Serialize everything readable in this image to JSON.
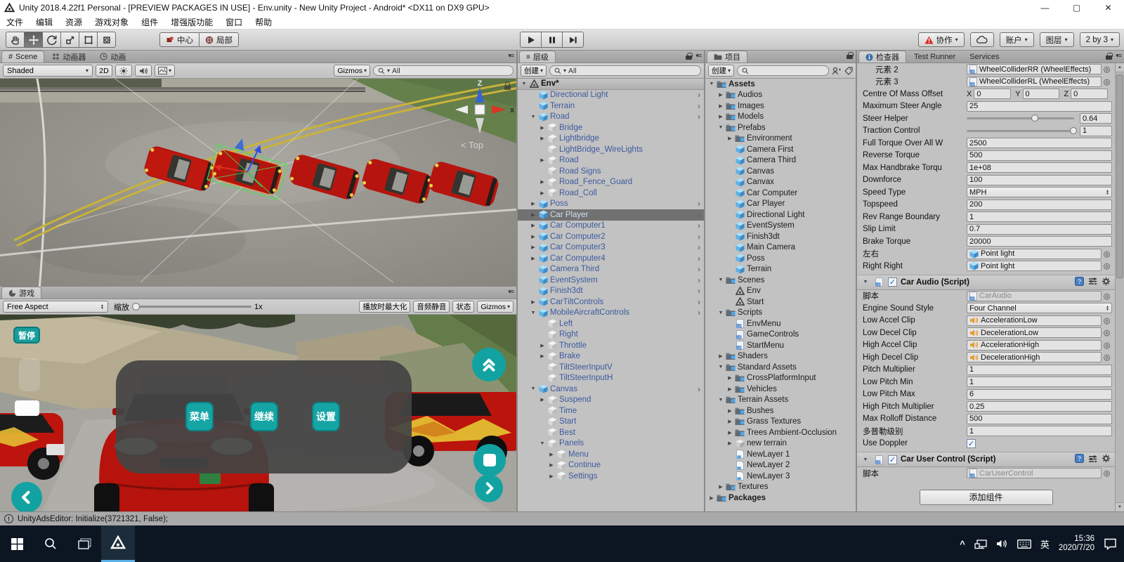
{
  "window": {
    "title": "Unity 2018.4.22f1 Personal - [PREVIEW PACKAGES IN USE] - Env.unity - New Unity Project - Android* <DX11 on DX9 GPU>",
    "menus": [
      "文件",
      "编辑",
      "资源",
      "游戏对象",
      "组件",
      "增强版功能",
      "窗口",
      "帮助"
    ]
  },
  "toolbar": {
    "center_label": "中心",
    "local_label": "局部",
    "collab_label": "协作",
    "account_label": "账户",
    "layers_label": "图层",
    "layout_label": "2 by 3",
    "accent_red": "#d82b1f",
    "tools": [
      "hand-tool",
      "move-tool",
      "rotate-tool",
      "scale-tool",
      "rect-tool",
      "transform-tool"
    ]
  },
  "scene_view": {
    "tabs": [
      {
        "label": "Scene"
      },
      {
        "label": "动画器"
      },
      {
        "label": "动画"
      }
    ],
    "toolbar": {
      "shaded": "Shaded",
      "two_d": "2D",
      "gizmos": "Gizmos",
      "search": "All"
    },
    "gizmo": {
      "z": "Z",
      "x": "x",
      "top_label": "< Top"
    }
  },
  "game_view": {
    "tab": "游戏",
    "toolbar": {
      "aspect": "Free Aspect",
      "zoom_label": "缩放",
      "zoom_value": "1x",
      "maximize": "播放时最大化",
      "mute": "音频静音",
      "stats": "状态",
      "gizmos": "Gizmos"
    },
    "overlay": {
      "pause_label": "暂停",
      "menu_buttons": [
        "菜单",
        "继续",
        "设置"
      ],
      "teal": "#16a5a5"
    }
  },
  "hierarchy": {
    "tab": "层级",
    "create_label": "创建",
    "search": "All",
    "items": [
      {
        "l": "Env*",
        "d": 0,
        "icon": "unity",
        "a": "down",
        "header": true
      },
      {
        "l": "Directional Light",
        "d": 1,
        "icon": "cube-b",
        "rch": true
      },
      {
        "l": "Terrain",
        "d": 1,
        "icon": "cube-b",
        "rch": true
      },
      {
        "l": "Road",
        "d": 1,
        "icon": "cube-b",
        "a": "down",
        "rch": true
      },
      {
        "l": "Bridge",
        "d": 2,
        "icon": "cube-g",
        "a": "right"
      },
      {
        "l": "Lightbridge",
        "d": 2,
        "icon": "cube-g",
        "a": "right"
      },
      {
        "l": "LightBridge_WireLights",
        "d": 2,
        "icon": "cube-g"
      },
      {
        "l": "Road",
        "d": 2,
        "icon": "cube-g",
        "a": "right"
      },
      {
        "l": "Road Signs",
        "d": 2,
        "icon": "cube-g"
      },
      {
        "l": "Road_Fence_Guard",
        "d": 2,
        "icon": "cube-g",
        "a": "right"
      },
      {
        "l": "Road_Coll",
        "d": 2,
        "icon": "cube-g",
        "a": "right"
      },
      {
        "l": "Poss",
        "d": 1,
        "icon": "cube-b",
        "a": "right",
        "rch": true
      },
      {
        "l": "Car Player",
        "d": 1,
        "icon": "cube-b",
        "a": "right",
        "sel": true,
        "rch": true
      },
      {
        "l": "Car Computer1",
        "d": 1,
        "icon": "cube-b",
        "a": "right",
        "rch": true
      },
      {
        "l": "Car Computer2",
        "d": 1,
        "icon": "cube-b",
        "a": "right",
        "rch": true
      },
      {
        "l": "Car Computer3",
        "d": 1,
        "icon": "cube-b",
        "a": "right",
        "rch": true
      },
      {
        "l": "Car Computer4",
        "d": 1,
        "icon": "cube-b",
        "a": "right",
        "rch": true
      },
      {
        "l": "Camera Third",
        "d": 1,
        "icon": "cube-b",
        "rch": true
      },
      {
        "l": "EventSystem",
        "d": 1,
        "icon": "cube-b",
        "rch": true
      },
      {
        "l": "Finish3dt",
        "d": 1,
        "icon": "cube-b",
        "rch": true
      },
      {
        "l": "CarTiltControls",
        "d": 1,
        "icon": "cube-b",
        "a": "right",
        "rch": true
      },
      {
        "l": "MobileAircraftControls",
        "d": 1,
        "icon": "cube-b",
        "a": "down",
        "rch": true
      },
      {
        "l": "Left",
        "d": 2,
        "icon": "cube-g"
      },
      {
        "l": "Right",
        "d": 2,
        "icon": "cube-g"
      },
      {
        "l": "Throttle",
        "d": 2,
        "icon": "cube-g",
        "a": "right"
      },
      {
        "l": "Brake",
        "d": 2,
        "icon": "cube-g",
        "a": "right"
      },
      {
        "l": "TiltSteerInputV",
        "d": 2,
        "icon": "cube-g"
      },
      {
        "l": "TiltSteerInputH",
        "d": 2,
        "icon": "cube-g"
      },
      {
        "l": "Canvas",
        "d": 1,
        "icon": "cube-b",
        "a": "down",
        "rch": true
      },
      {
        "l": "Suspend",
        "d": 2,
        "icon": "cube-g",
        "a": "right"
      },
      {
        "l": "Time",
        "d": 2,
        "icon": "cube-g"
      },
      {
        "l": "Start",
        "d": 2,
        "icon": "cube-g"
      },
      {
        "l": "Best",
        "d": 2,
        "icon": "cube-g"
      },
      {
        "l": "Panels",
        "d": 2,
        "icon": "cube-g",
        "a": "down"
      },
      {
        "l": "Menu",
        "d": 3,
        "icon": "cube-g",
        "a": "right"
      },
      {
        "l": "Continue",
        "d": 3,
        "icon": "cube-g",
        "a": "right"
      },
      {
        "l": "Settings",
        "d": 3,
        "icon": "cube-g",
        "a": "right"
      }
    ]
  },
  "project": {
    "tab": "项目",
    "create_label": "创建",
    "items": [
      {
        "l": "Assets",
        "d": 0,
        "icon": "folder",
        "a": "down",
        "bold": true
      },
      {
        "l": "Audios",
        "d": 1,
        "icon": "folder",
        "a": "right"
      },
      {
        "l": "Images",
        "d": 1,
        "icon": "folder",
        "a": "right"
      },
      {
        "l": "Models",
        "d": 1,
        "icon": "folder",
        "a": "right"
      },
      {
        "l": "Prefabs",
        "d": 1,
        "icon": "folder",
        "a": "down"
      },
      {
        "l": "Environment",
        "d": 2,
        "icon": "folder",
        "a": "right"
      },
      {
        "l": "Camera First",
        "d": 2,
        "icon": "cube-b"
      },
      {
        "l": "Camera Third",
        "d": 2,
        "icon": "cube-b"
      },
      {
        "l": "Canvas",
        "d": 2,
        "icon": "cube-b"
      },
      {
        "l": "Canvax",
        "d": 2,
        "icon": "cube-b"
      },
      {
        "l": "Car Computer",
        "d": 2,
        "icon": "cube-b"
      },
      {
        "l": "Car Player",
        "d": 2,
        "icon": "cube-b"
      },
      {
        "l": "Directional Light",
        "d": 2,
        "icon": "cube-b"
      },
      {
        "l": "EventSystem",
        "d": 2,
        "icon": "cube-b"
      },
      {
        "l": "Finish3dt",
        "d": 2,
        "icon": "cube-b"
      },
      {
        "l": "Main Camera",
        "d": 2,
        "icon": "cube-b"
      },
      {
        "l": "Poss",
        "d": 2,
        "icon": "cube-b"
      },
      {
        "l": "Terrain",
        "d": 2,
        "icon": "cube-b"
      },
      {
        "l": "Scenes",
        "d": 1,
        "icon": "folder",
        "a": "down"
      },
      {
        "l": "Env",
        "d": 2,
        "icon": "unity"
      },
      {
        "l": "Start",
        "d": 2,
        "icon": "unity"
      },
      {
        "l": "Scripts",
        "d": 1,
        "icon": "folder",
        "a": "down"
      },
      {
        "l": "EnvMenu",
        "d": 2,
        "icon": "script"
      },
      {
        "l": "GameControls",
        "d": 2,
        "icon": "script"
      },
      {
        "l": "StartMenu",
        "d": 2,
        "icon": "script"
      },
      {
        "l": "Shaders",
        "d": 1,
        "icon": "folder",
        "a": "right"
      },
      {
        "l": "Standard Assets",
        "d": 1,
        "icon": "folder",
        "a": "down"
      },
      {
        "l": "CrossPlatformInput",
        "d": 2,
        "icon": "folder",
        "a": "right"
      },
      {
        "l": "Vehicles",
        "d": 2,
        "icon": "folder",
        "a": "right"
      },
      {
        "l": "Terrain Assets",
        "d": 1,
        "icon": "folder",
        "a": "down"
      },
      {
        "l": "Bushes",
        "d": 2,
        "icon": "folder",
        "a": "right"
      },
      {
        "l": "Grass Textures",
        "d": 2,
        "icon": "folder",
        "a": "right"
      },
      {
        "l": "Trees Ambient-Occlusion",
        "d": 2,
        "icon": "folder",
        "a": "right"
      },
      {
        "l": "new terrain",
        "d": 2,
        "icon": "terrain",
        "a": "right"
      },
      {
        "l": "NewLayer 1",
        "d": 2,
        "icon": "file"
      },
      {
        "l": "NewLayer 2",
        "d": 2,
        "icon": "file"
      },
      {
        "l": "NewLayer 3",
        "d": 2,
        "icon": "file"
      },
      {
        "l": "Textures",
        "d": 1,
        "icon": "folder",
        "a": "right"
      },
      {
        "l": "Packages",
        "d": 0,
        "icon": "folder",
        "a": "right",
        "bold": true
      }
    ]
  },
  "inspector": {
    "tabs": [
      "检查器",
      "Test Runner",
      "Services"
    ],
    "add_component_label": "添加组件",
    "sections": [
      {
        "component": null,
        "rows": [
          {
            "label": "元素 2",
            "type": "object",
            "value": "WheelColliderRR (WheelEffects)",
            "icon": "script",
            "indent": true
          },
          {
            "label": "元素 3",
            "type": "object",
            "value": "WheelColliderRL (WheelEffects)",
            "icon": "script",
            "indent": true
          },
          {
            "label": "Centre Of Mass Offset",
            "type": "vector3",
            "x": "0",
            "y": "0",
            "z": "0"
          },
          {
            "label": "Maximum Steer Angle",
            "type": "text",
            "value": "25"
          },
          {
            "label": "Steer Helper",
            "type": "slider",
            "value": "0.64",
            "frac": 0.64
          },
          {
            "label": "Traction Control",
            "type": "slider",
            "value": "1",
            "frac": 1
          },
          {
            "label": "Full Torque Over All W",
            "type": "text",
            "value": "2500"
          },
          {
            "label": "Reverse Torque",
            "type": "text",
            "value": "500"
          },
          {
            "label": "Max Handbrake Torqu",
            "type": "text",
            "value": "1e+08"
          },
          {
            "label": "Downforce",
            "type": "text",
            "value": "100"
          },
          {
            "label": "Speed Type",
            "type": "dropdown",
            "value": "MPH"
          },
          {
            "label": "Topspeed",
            "type": "text",
            "value": "200"
          },
          {
            "label": "Rev Range Boundary",
            "type": "text",
            "value": "1"
          },
          {
            "label": "Slip Limit",
            "type": "text",
            "value": "0.7"
          },
          {
            "label": "Brake Torque",
            "type": "text",
            "value": "20000"
          },
          {
            "label": "左右",
            "type": "object",
            "value": "Point light",
            "icon": "cube-b"
          },
          {
            "label": "Right Right",
            "type": "object",
            "value": "Point light",
            "icon": "cube-b"
          }
        ]
      },
      {
        "component": "Car Audio (Script)",
        "enabled": true,
        "rows": [
          {
            "label": "脚本",
            "type": "script",
            "value": "CarAudio"
          },
          {
            "label": "Engine Sound Style",
            "type": "dropdown",
            "value": "Four Channel"
          },
          {
            "label": "Low Accel Clip",
            "type": "object",
            "value": "AccelerationLow",
            "icon": "audio"
          },
          {
            "label": "Low Decel Clip",
            "type": "object",
            "value": "DecelerationLow",
            "icon": "audio"
          },
          {
            "label": "High Accel Clip",
            "type": "object",
            "value": "AccelerationHigh",
            "icon": "audio"
          },
          {
            "label": "High Decel Clip",
            "type": "object",
            "value": "DecelerationHigh",
            "icon": "audio"
          },
          {
            "label": "Pitch Multiplier",
            "type": "text",
            "value": "1"
          },
          {
            "label": "Low Pitch Min",
            "type": "text",
            "value": "1"
          },
          {
            "label": "Low Pitch Max",
            "type": "text",
            "value": "6"
          },
          {
            "label": "High Pitch Multiplier",
            "type": "text",
            "value": "0.25"
          },
          {
            "label": "Max Rolloff Distance",
            "type": "text",
            "value": "500"
          },
          {
            "label": "多普勒级别",
            "type": "text",
            "value": "1"
          },
          {
            "label": "Use Doppler",
            "type": "checkbox",
            "checked": true
          }
        ]
      },
      {
        "component": "Car User Control (Script)",
        "enabled": true,
        "rows": [
          {
            "label": "脚本",
            "type": "script",
            "value": "CarUserControl"
          }
        ]
      }
    ]
  },
  "status_bar": {
    "message": "UnityAdsEditor: Initialize(3721321, False);"
  },
  "taskbar": {
    "lang": "英",
    "time": "15:36",
    "date": "2020/7/20"
  }
}
